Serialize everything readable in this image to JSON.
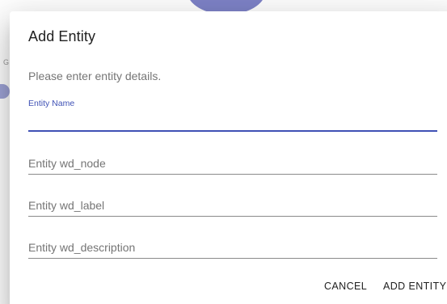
{
  "dialog": {
    "title": "Add Entity",
    "description": "Please enter entity details.",
    "fields": [
      {
        "label": "Entity Name",
        "value": "",
        "placeholder": ""
      },
      {
        "label": "",
        "value": "",
        "placeholder": "Entity wd_node"
      },
      {
        "label": "",
        "value": "",
        "placeholder": "Entity wd_label"
      },
      {
        "label": "",
        "value": "",
        "placeholder": "Entity wd_description"
      }
    ],
    "actions": {
      "cancel_label": "CANCEL",
      "submit_label": "ADD ENTITY"
    }
  },
  "background": {
    "partial_letter": "G"
  },
  "colors": {
    "accent": "#3f51b5",
    "text_primary": "#212121",
    "text_secondary": "#757575",
    "divider": "#8a8a8a"
  }
}
